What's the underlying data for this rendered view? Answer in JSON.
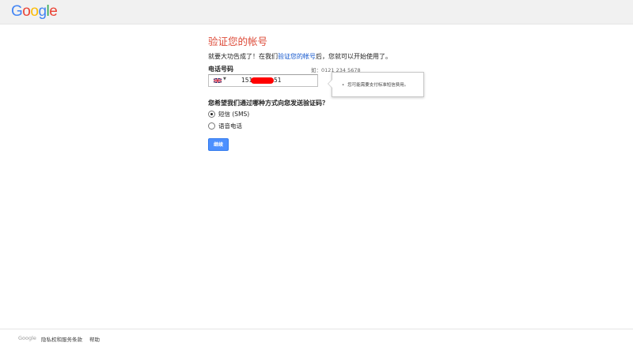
{
  "header": {
    "logo_letters": [
      {
        "ch": "G",
        "color": "#4285f4"
      },
      {
        "ch": "o",
        "color": "#ea4335"
      },
      {
        "ch": "o",
        "color": "#fbbc05"
      },
      {
        "ch": "g",
        "color": "#4285f4"
      },
      {
        "ch": "l",
        "color": "#34a853"
      },
      {
        "ch": "e",
        "color": "#ea4335"
      }
    ]
  },
  "main": {
    "title": "验证您的帐号",
    "intro_before": "就要大功告成了！在我们",
    "intro_link": "验证您的帐号",
    "intro_after": "后，您就可以开始使用了。",
    "phone": {
      "label": "电话号码",
      "example": "如：0121 234 5678",
      "country_flag": "uk-flag-icon",
      "value_start": "151",
      "value_end": "51"
    },
    "tooltip_text": "您可能需要支付标准短信费用。",
    "question": "您希望我们通过哪种方式向您发送验证码？",
    "options": [
      {
        "label": "短信 (SMS)",
        "selected": true
      },
      {
        "label": "语音电话",
        "selected": false
      }
    ],
    "submit_label": "继续"
  },
  "footer": {
    "brand": "Google",
    "links": [
      "隐私权和服务条款",
      "帮助"
    ]
  },
  "colors": {
    "title": "#dd4b39",
    "link": "#1155cc",
    "button": "#4d90fe",
    "redaction": "#ff0000"
  }
}
